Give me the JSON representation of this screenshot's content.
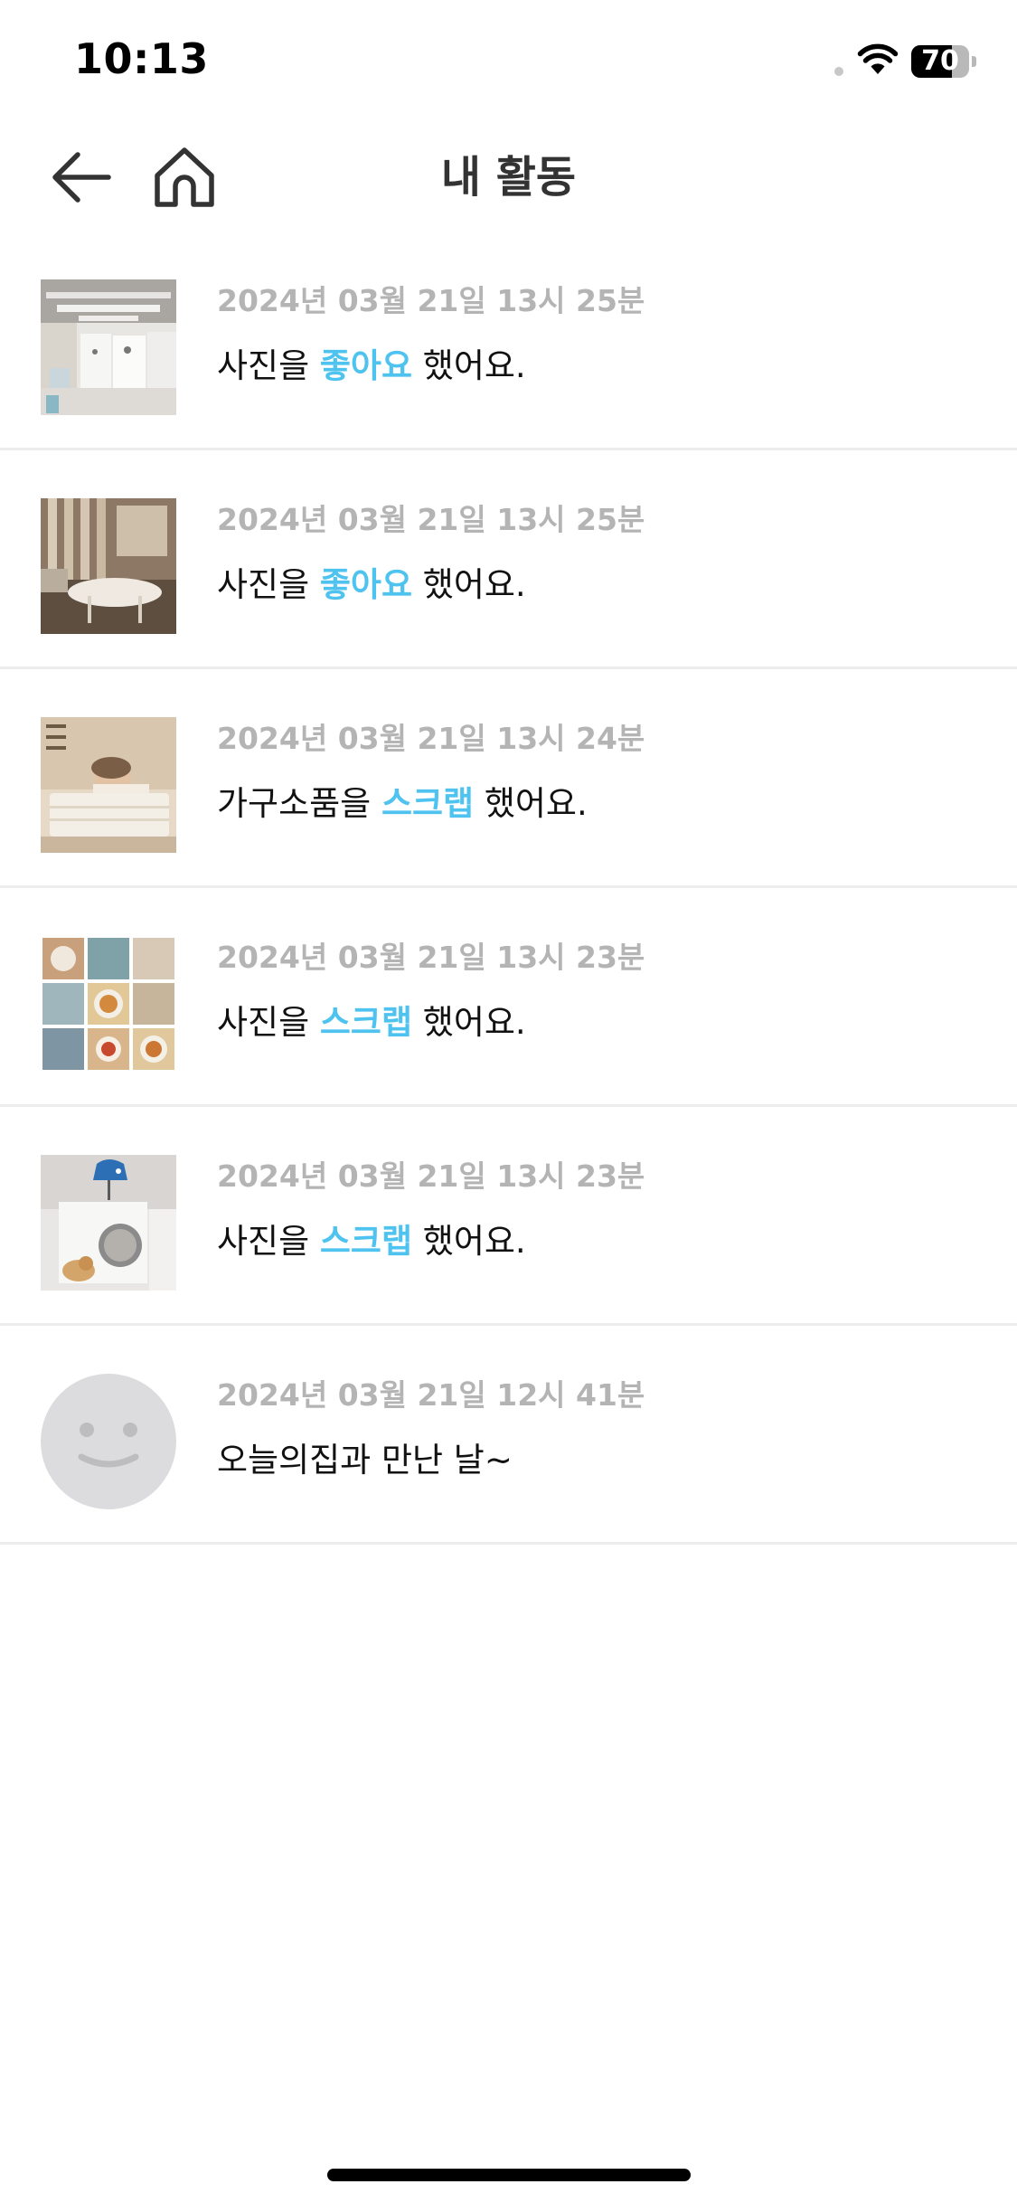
{
  "status_bar": {
    "time": "10:13",
    "battery": "70",
    "battery_level": 0.7
  },
  "nav": {
    "title": "내 활동"
  },
  "colors": {
    "accent": "#4fc3f0",
    "date_text": "#b4b4b4",
    "divider": "#ededed"
  },
  "activities": [
    {
      "date": "2024년 03월 21일 13시 25분",
      "prefix": "사진을 ",
      "action": "좋아요",
      "suffix": " 했어요."
    },
    {
      "date": "2024년 03월 21일 13시 25분",
      "prefix": "사진을 ",
      "action": "좋아요",
      "suffix": " 했어요."
    },
    {
      "date": "2024년 03월 21일 13시 24분",
      "prefix": "가구소품을 ",
      "action": "스크랩",
      "suffix": " 했어요."
    },
    {
      "date": "2024년 03월 21일 13시 23분",
      "prefix": "사진을 ",
      "action": "스크랩",
      "suffix": " 했어요."
    },
    {
      "date": "2024년 03월 21일 13시 23분",
      "prefix": "사진을 ",
      "action": "스크랩",
      "suffix": " 했어요."
    },
    {
      "date": "2024년 03월 21일 12시 41분",
      "prefix": "오늘의집과 만난 날~",
      "action": "",
      "suffix": ""
    }
  ]
}
